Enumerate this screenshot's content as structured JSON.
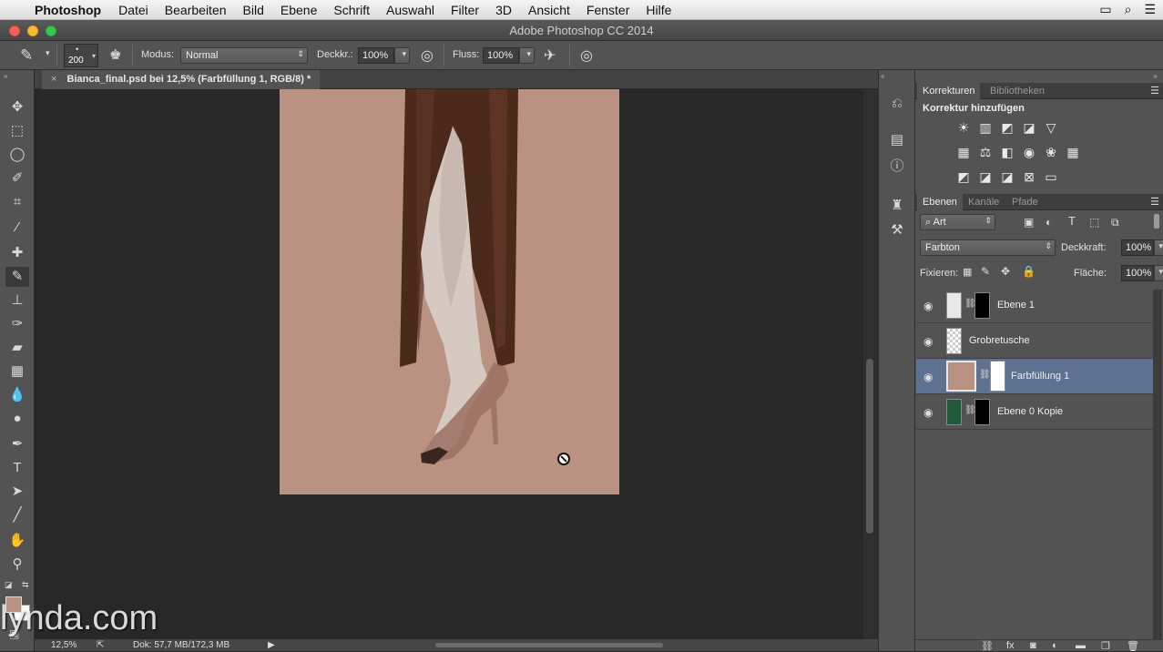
{
  "menubar": {
    "app_name": "Photoshop",
    "items": [
      "Datei",
      "Bearbeiten",
      "Bild",
      "Ebene",
      "Schrift",
      "Auswahl",
      "Filter",
      "3D",
      "Ansicht",
      "Fenster",
      "Hilfe"
    ]
  },
  "window": {
    "title": "Adobe Photoshop CC 2014"
  },
  "options": {
    "brush_size": "200",
    "mode_label": "Modus:",
    "mode_value": "Normal",
    "opacity_label": "Deckkr.:",
    "opacity_value": "100%",
    "flow_label": "Fluss:",
    "flow_value": "100%"
  },
  "document": {
    "tab_title": "Bianca_final.psd bei 12,5% (Farbfüllung 1, RGB/8) *",
    "close_glyph": "×",
    "fill_color": "#b99282"
  },
  "status": {
    "zoom": "12,5%",
    "doc_info": "Dok: 57,7 MB/172,3 MB"
  },
  "adjustments_panel": {
    "tabs": [
      "Korrekturen",
      "Bibliotheken"
    ],
    "heading": "Korrektur hinzufügen"
  },
  "layers_panel": {
    "tabs": [
      "Ebenen",
      "Kanäle",
      "Pfade"
    ],
    "filter_value": "Art",
    "blend_mode": "Farbton",
    "opacity_label": "Deckkraft:",
    "opacity_value": "100%",
    "lock_label": "Fixieren:",
    "fill_label": "Fläche:",
    "fill_value": "100%",
    "layers": [
      {
        "name": "Ebene 1",
        "selected": false
      },
      {
        "name": "Grobretusche",
        "selected": false
      },
      {
        "name": "Farbfüllung 1",
        "selected": true
      },
      {
        "name": "Ebene 0 Kopie",
        "selected": false
      }
    ]
  },
  "watermark": "lynda.com",
  "colors": {
    "accent_selected": "#5d7290",
    "foreground_swatch": "#b99282",
    "panel_bg": "#535353"
  }
}
